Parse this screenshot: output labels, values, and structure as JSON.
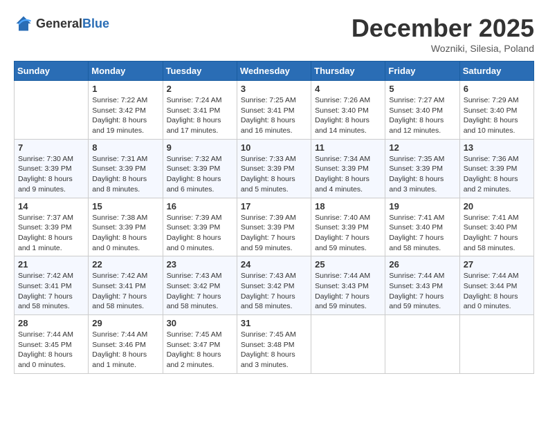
{
  "logo": {
    "general": "General",
    "blue": "Blue"
  },
  "title": "December 2025",
  "location": "Wozniki, Silesia, Poland",
  "days_of_week": [
    "Sunday",
    "Monday",
    "Tuesday",
    "Wednesday",
    "Thursday",
    "Friday",
    "Saturday"
  ],
  "weeks": [
    [
      {
        "day": "",
        "sunrise": "",
        "sunset": "",
        "daylight": ""
      },
      {
        "day": "1",
        "sunrise": "Sunrise: 7:22 AM",
        "sunset": "Sunset: 3:42 PM",
        "daylight": "Daylight: 8 hours and 19 minutes."
      },
      {
        "day": "2",
        "sunrise": "Sunrise: 7:24 AM",
        "sunset": "Sunset: 3:41 PM",
        "daylight": "Daylight: 8 hours and 17 minutes."
      },
      {
        "day": "3",
        "sunrise": "Sunrise: 7:25 AM",
        "sunset": "Sunset: 3:41 PM",
        "daylight": "Daylight: 8 hours and 16 minutes."
      },
      {
        "day": "4",
        "sunrise": "Sunrise: 7:26 AM",
        "sunset": "Sunset: 3:40 PM",
        "daylight": "Daylight: 8 hours and 14 minutes."
      },
      {
        "day": "5",
        "sunrise": "Sunrise: 7:27 AM",
        "sunset": "Sunset: 3:40 PM",
        "daylight": "Daylight: 8 hours and 12 minutes."
      },
      {
        "day": "6",
        "sunrise": "Sunrise: 7:29 AM",
        "sunset": "Sunset: 3:40 PM",
        "daylight": "Daylight: 8 hours and 10 minutes."
      }
    ],
    [
      {
        "day": "7",
        "sunrise": "Sunrise: 7:30 AM",
        "sunset": "Sunset: 3:39 PM",
        "daylight": "Daylight: 8 hours and 9 minutes."
      },
      {
        "day": "8",
        "sunrise": "Sunrise: 7:31 AM",
        "sunset": "Sunset: 3:39 PM",
        "daylight": "Daylight: 8 hours and 8 minutes."
      },
      {
        "day": "9",
        "sunrise": "Sunrise: 7:32 AM",
        "sunset": "Sunset: 3:39 PM",
        "daylight": "Daylight: 8 hours and 6 minutes."
      },
      {
        "day": "10",
        "sunrise": "Sunrise: 7:33 AM",
        "sunset": "Sunset: 3:39 PM",
        "daylight": "Daylight: 8 hours and 5 minutes."
      },
      {
        "day": "11",
        "sunrise": "Sunrise: 7:34 AM",
        "sunset": "Sunset: 3:39 PM",
        "daylight": "Daylight: 8 hours and 4 minutes."
      },
      {
        "day": "12",
        "sunrise": "Sunrise: 7:35 AM",
        "sunset": "Sunset: 3:39 PM",
        "daylight": "Daylight: 8 hours and 3 minutes."
      },
      {
        "day": "13",
        "sunrise": "Sunrise: 7:36 AM",
        "sunset": "Sunset: 3:39 PM",
        "daylight": "Daylight: 8 hours and 2 minutes."
      }
    ],
    [
      {
        "day": "14",
        "sunrise": "Sunrise: 7:37 AM",
        "sunset": "Sunset: 3:39 PM",
        "daylight": "Daylight: 8 hours and 1 minute."
      },
      {
        "day": "15",
        "sunrise": "Sunrise: 7:38 AM",
        "sunset": "Sunset: 3:39 PM",
        "daylight": "Daylight: 8 hours and 0 minutes."
      },
      {
        "day": "16",
        "sunrise": "Sunrise: 7:39 AM",
        "sunset": "Sunset: 3:39 PM",
        "daylight": "Daylight: 8 hours and 0 minutes."
      },
      {
        "day": "17",
        "sunrise": "Sunrise: 7:39 AM",
        "sunset": "Sunset: 3:39 PM",
        "daylight": "Daylight: 7 hours and 59 minutes."
      },
      {
        "day": "18",
        "sunrise": "Sunrise: 7:40 AM",
        "sunset": "Sunset: 3:39 PM",
        "daylight": "Daylight: 7 hours and 59 minutes."
      },
      {
        "day": "19",
        "sunrise": "Sunrise: 7:41 AM",
        "sunset": "Sunset: 3:40 PM",
        "daylight": "Daylight: 7 hours and 58 minutes."
      },
      {
        "day": "20",
        "sunrise": "Sunrise: 7:41 AM",
        "sunset": "Sunset: 3:40 PM",
        "daylight": "Daylight: 7 hours and 58 minutes."
      }
    ],
    [
      {
        "day": "21",
        "sunrise": "Sunrise: 7:42 AM",
        "sunset": "Sunset: 3:41 PM",
        "daylight": "Daylight: 7 hours and 58 minutes."
      },
      {
        "day": "22",
        "sunrise": "Sunrise: 7:42 AM",
        "sunset": "Sunset: 3:41 PM",
        "daylight": "Daylight: 7 hours and 58 minutes."
      },
      {
        "day": "23",
        "sunrise": "Sunrise: 7:43 AM",
        "sunset": "Sunset: 3:42 PM",
        "daylight": "Daylight: 7 hours and 58 minutes."
      },
      {
        "day": "24",
        "sunrise": "Sunrise: 7:43 AM",
        "sunset": "Sunset: 3:42 PM",
        "daylight": "Daylight: 7 hours and 58 minutes."
      },
      {
        "day": "25",
        "sunrise": "Sunrise: 7:44 AM",
        "sunset": "Sunset: 3:43 PM",
        "daylight": "Daylight: 7 hours and 59 minutes."
      },
      {
        "day": "26",
        "sunrise": "Sunrise: 7:44 AM",
        "sunset": "Sunset: 3:43 PM",
        "daylight": "Daylight: 7 hours and 59 minutes."
      },
      {
        "day": "27",
        "sunrise": "Sunrise: 7:44 AM",
        "sunset": "Sunset: 3:44 PM",
        "daylight": "Daylight: 8 hours and 0 minutes."
      }
    ],
    [
      {
        "day": "28",
        "sunrise": "Sunrise: 7:44 AM",
        "sunset": "Sunset: 3:45 PM",
        "daylight": "Daylight: 8 hours and 0 minutes."
      },
      {
        "day": "29",
        "sunrise": "Sunrise: 7:44 AM",
        "sunset": "Sunset: 3:46 PM",
        "daylight": "Daylight: 8 hours and 1 minute."
      },
      {
        "day": "30",
        "sunrise": "Sunrise: 7:45 AM",
        "sunset": "Sunset: 3:47 PM",
        "daylight": "Daylight: 8 hours and 2 minutes."
      },
      {
        "day": "31",
        "sunrise": "Sunrise: 7:45 AM",
        "sunset": "Sunset: 3:48 PM",
        "daylight": "Daylight: 8 hours and 3 minutes."
      },
      {
        "day": "",
        "sunrise": "",
        "sunset": "",
        "daylight": ""
      },
      {
        "day": "",
        "sunrise": "",
        "sunset": "",
        "daylight": ""
      },
      {
        "day": "",
        "sunrise": "",
        "sunset": "",
        "daylight": ""
      }
    ]
  ]
}
